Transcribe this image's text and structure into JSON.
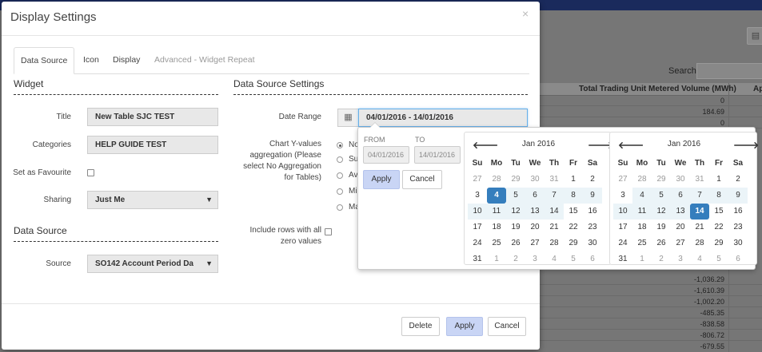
{
  "background": {
    "search_label": "Search:",
    "col_header_1": "Total Trading Unit Metered Volume (MWh)",
    "col_header_2": "Ap",
    "values_top": [
      "0",
      "184.69",
      "0"
    ],
    "values_bottom": [
      "-1,036.29",
      "-1,610.39",
      "-1,002.20",
      "-485.35",
      "-838.58",
      "-806.72",
      "-679.55"
    ]
  },
  "modal": {
    "title": "Display Settings",
    "close": "×",
    "tabs": [
      {
        "label": "Data Source"
      },
      {
        "label": "Icon"
      },
      {
        "label": "Display"
      },
      {
        "label": "Advanced - Widget Repeat"
      }
    ],
    "widget": {
      "heading": "Widget",
      "title_label": "Title",
      "title_value": "New Table SJC TEST",
      "categories_label": "Categories",
      "categories_value": "HELP GUIDE TEST",
      "favourite_label": "Set as Favourite",
      "sharing_label": "Sharing",
      "sharing_value": "Just Me"
    },
    "datasource": {
      "heading": "Data Source",
      "source_label": "Source",
      "source_value": "SO142 Account Period Da"
    },
    "settings": {
      "heading": "Data Source Settings",
      "date_range_label": "Date Range",
      "date_range_value": "04/01/2016 - 14/01/2016",
      "aggregation_label_1": "Chart Y-values",
      "aggregation_label_2": "aggregation (Please",
      "aggregation_label_3": "select No Aggregation",
      "aggregation_label_4": "for Tables)",
      "agg_options": [
        "No",
        "Su",
        "Av",
        "Mi",
        "Ma"
      ],
      "zero_label_1": "Include rows with all",
      "zero_label_2": "zero values"
    },
    "footer": {
      "delete": "Delete",
      "apply": "Apply",
      "cancel": "Cancel"
    }
  },
  "picker": {
    "from_label": "FROM",
    "to_label": "TO",
    "from_value": "04/01/2016",
    "to_value": "14/01/2016",
    "apply": "Apply",
    "cancel": "Cancel",
    "prev": "🡐",
    "next": "🡒",
    "left_month": "Jan 2016",
    "right_month": "Jan 2016",
    "dow": [
      "Su",
      "Mo",
      "Tu",
      "We",
      "Th",
      "Fr",
      "Sa"
    ],
    "days": [
      "27",
      "28",
      "29",
      "30",
      "31",
      "1",
      "2",
      "3",
      "4",
      "5",
      "6",
      "7",
      "8",
      "9",
      "10",
      "11",
      "12",
      "13",
      "14",
      "15",
      "16",
      "17",
      "18",
      "19",
      "20",
      "21",
      "22",
      "23",
      "24",
      "25",
      "26",
      "27",
      "28",
      "29",
      "30",
      "31",
      "1",
      "2",
      "3",
      "4",
      "5",
      "6"
    ]
  }
}
